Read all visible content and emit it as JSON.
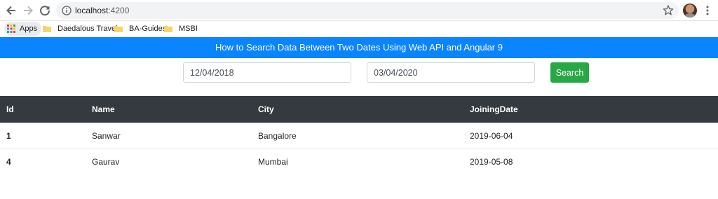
{
  "browser": {
    "url_host": "localhost",
    "url_port": ":4200",
    "bookmarks": [
      {
        "label": "Apps"
      },
      {
        "label": "Daedalous Travels"
      },
      {
        "label": "BA-Guides"
      },
      {
        "label": "MSBI"
      }
    ]
  },
  "page": {
    "title": "How to Search Data Between Two Dates Using Web API and Angular 9",
    "from_date": "12/04/2018",
    "to_date": "03/04/2020",
    "search_label": "Search"
  },
  "table": {
    "columns": [
      "Id",
      "Name",
      "City",
      "JoiningDate"
    ],
    "rows": [
      [
        "1",
        "Sanwar",
        "Bangalore",
        "2019-06-04"
      ],
      [
        "4",
        "Gaurav",
        "Mumbai",
        "2019-05-08"
      ]
    ]
  },
  "colors": {
    "title_bar": "#0a84ff",
    "search_button": "#28a745",
    "table_header": "#343a40"
  }
}
